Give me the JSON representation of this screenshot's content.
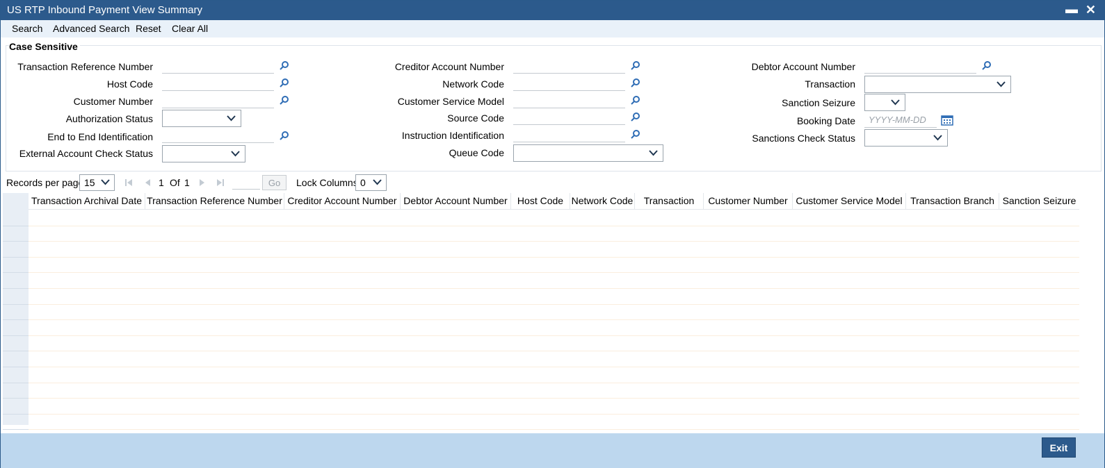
{
  "window": {
    "title": "US RTP Inbound Payment View Summary",
    "minimize_glyph": "▬",
    "close_glyph": "✕"
  },
  "toolbar": {
    "search": "Search",
    "advanced_search": "Advanced Search",
    "reset": "Reset",
    "clear_all": "Clear All"
  },
  "criteria": {
    "legend": "Case Sensitive",
    "col1": {
      "txn_ref": "Transaction Reference Number",
      "host_code": "Host Code",
      "customer_number": "Customer Number",
      "auth_status": "Authorization Status",
      "e2e_id": "End to End Identification",
      "ext_acc_check": "External Account Check Status"
    },
    "col2": {
      "creditor_acc": "Creditor Account Number",
      "network_code": "Network Code",
      "csm": "Customer Service Model",
      "source_code": "Source Code",
      "instr_id": "Instruction Identification",
      "queue_code": "Queue Code"
    },
    "col3": {
      "debtor_acc": "Debtor Account Number",
      "transaction": "Transaction",
      "sanction_seizure": "Sanction Seizure",
      "booking_date": "Booking Date",
      "booking_date_placeholder": "YYYY-MM-DD",
      "sanctions_check": "Sanctions Check Status"
    }
  },
  "pager": {
    "records_per_page_label": "Records per page",
    "records_per_page_value": "15",
    "current_page": "1",
    "of_label": "Of",
    "total_pages": "1",
    "go_label": "Go",
    "lock_columns_label": "Lock Columns",
    "lock_columns_value": "0"
  },
  "grid": {
    "columns": [
      "Transaction Archival Date",
      "Transaction Reference Number",
      "Creditor Account Number",
      "Debtor Account Number",
      "Host Code",
      "Network Code",
      "Transaction",
      "Customer Number",
      "Customer Service Model",
      "Transaction Branch",
      "Sanction Seizure"
    ]
  },
  "footer": {
    "exit": "Exit"
  },
  "colors": {
    "title_bg": "#2c5a8c",
    "toolbar_bg": "#e9f1f9",
    "footer_bg": "#bdd7ee",
    "icon_blue": "#2f6db5"
  }
}
